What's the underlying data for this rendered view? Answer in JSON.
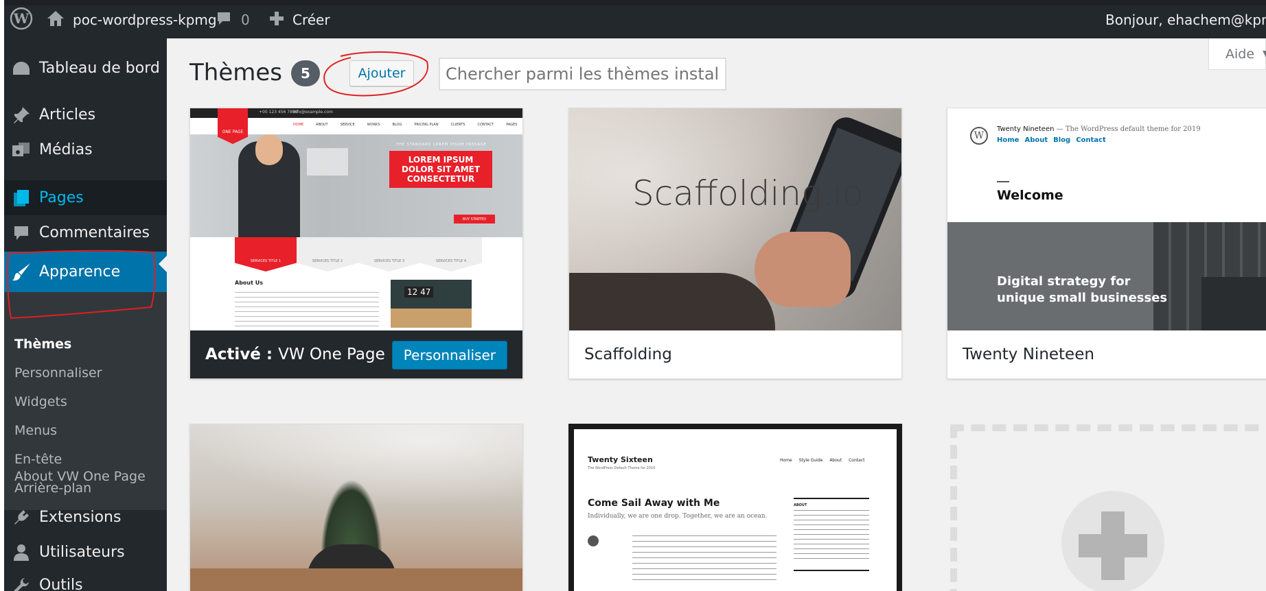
{
  "adminbar": {
    "site_name": "poc-wordpress-kpmg",
    "comments_count": "0",
    "new_label": "Créer",
    "greeting": "Bonjour, ehachem@kpmg.f"
  },
  "sidebar": {
    "items": [
      {
        "label": "Tableau de bord",
        "icon": "dashboard-icon"
      },
      {
        "label": "Articles",
        "icon": "pin-icon"
      },
      {
        "label": "Médias",
        "icon": "media-icon"
      },
      {
        "label": "Pages",
        "icon": "pages-icon"
      },
      {
        "label": "Commentaires",
        "icon": "comment-icon"
      },
      {
        "label": "Apparence",
        "icon": "brush-icon"
      },
      {
        "label": "Extensions",
        "icon": "plugin-icon"
      },
      {
        "label": "Utilisateurs",
        "icon": "user-icon"
      },
      {
        "label": "Outils",
        "icon": "wrench-icon"
      }
    ],
    "submenu": [
      "Thèmes",
      "Personnaliser",
      "Widgets",
      "Menus",
      "En-tête",
      "Arrière-plan",
      "About VW One Page"
    ]
  },
  "header": {
    "title": "Thèmes",
    "count": "5",
    "add_label": "Ajouter",
    "search_placeholder": "Chercher parmi les thèmes installés",
    "help_label": "Aide"
  },
  "themes": {
    "vw": {
      "active_prefix": "Activé :",
      "name": "VW One Page",
      "customize_label": "Personnaliser",
      "shot": {
        "topbar_phone": "+00 123 456 7890",
        "topbar_email": "info@example.com",
        "logo": "ONE PAGE",
        "nav": [
          "HOME",
          "ABOUT",
          "SERVICE",
          "WORKS",
          "BLOG",
          "PRICING PLAN",
          "CLIENTS",
          "CONTACT",
          "PAGES"
        ],
        "kicker": "THE STANDARD LOREM IPSUM PASSAGE",
        "hero_title": "LOREM IPSUM DOLOR SIT AMET CONSECTETUR",
        "hero_button": "BUY STARTED",
        "services": [
          "SERVICES TITLE 1",
          "SERVICES TITLE 2",
          "SERVICES TITLE 3",
          "SERVICES TITLE 4"
        ],
        "about_title": "About Us",
        "clock": "12 47"
      }
    },
    "scaffolding": {
      "name": "Scaffolding",
      "shot_text": "Scaffolding.io"
    },
    "nineteen": {
      "name": "Twenty Nineteen",
      "shot": {
        "site_title": "Twenty Nineteen",
        "tagline": "— The WordPress default theme for 2019",
        "nav": [
          "Home",
          "About",
          "Blog",
          "Contact"
        ],
        "welcome": "Welcome",
        "headline_1": "Digital strategy for",
        "headline_2": "unique small businesses"
      }
    },
    "sixteen": {
      "shot": {
        "site_title": "Twenty Sixteen",
        "tagline": "The WordPress Default Theme for 2016",
        "nav": [
          "Home",
          "Style Guide",
          "About",
          "Contact"
        ],
        "post_title": "Come Sail Away with Me",
        "post_lead": "Individually, we are one drop. Together, we are an ocean.",
        "about_label": "ABOUT"
      }
    }
  },
  "colors": {
    "adminbar": "#23282d",
    "accent": "#0073aa",
    "button": "#0085ba",
    "annotation": "#e02020"
  }
}
